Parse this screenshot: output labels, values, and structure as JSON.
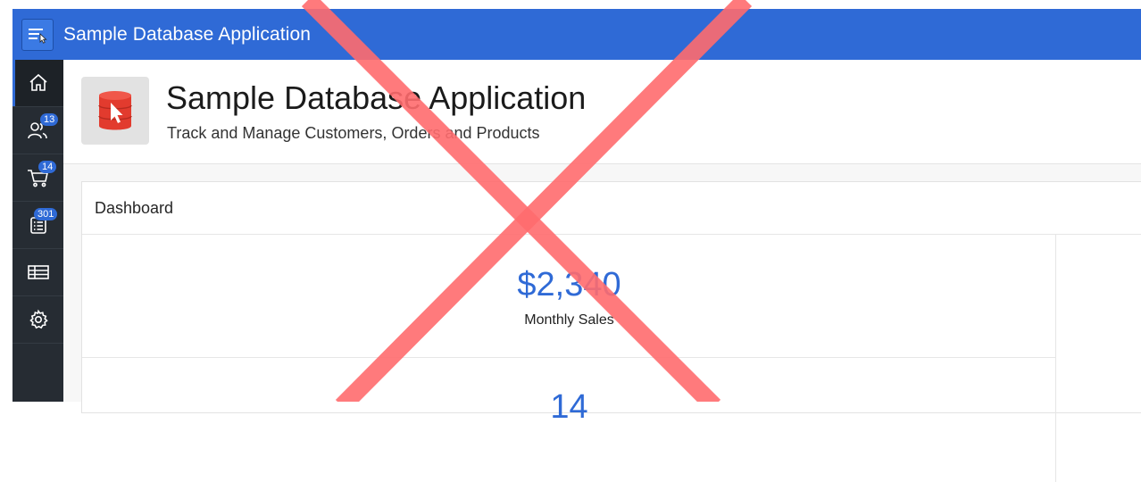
{
  "app": {
    "title": "Sample Database Application"
  },
  "sidebar": {
    "items": [
      {
        "icon": "home-icon",
        "badge": ""
      },
      {
        "icon": "customers-icon",
        "badge": "13"
      },
      {
        "icon": "cart-icon",
        "badge": "14"
      },
      {
        "icon": "list-icon",
        "badge": "301"
      },
      {
        "icon": "table-icon",
        "badge": ""
      },
      {
        "icon": "gear-icon",
        "badge": ""
      }
    ]
  },
  "hero": {
    "title": "Sample Database Application",
    "subtitle": "Track and Manage Customers, Orders and Products"
  },
  "dashboard": {
    "title": "Dashboard",
    "metrics": [
      {
        "value": "$2,340",
        "label": "Monthly Sales"
      },
      {
        "value": "14",
        "label": ""
      }
    ]
  },
  "colors": {
    "accent": "#2f6ad6",
    "sidebar": "#262c33",
    "overlay_x": "#ff6b6e"
  }
}
